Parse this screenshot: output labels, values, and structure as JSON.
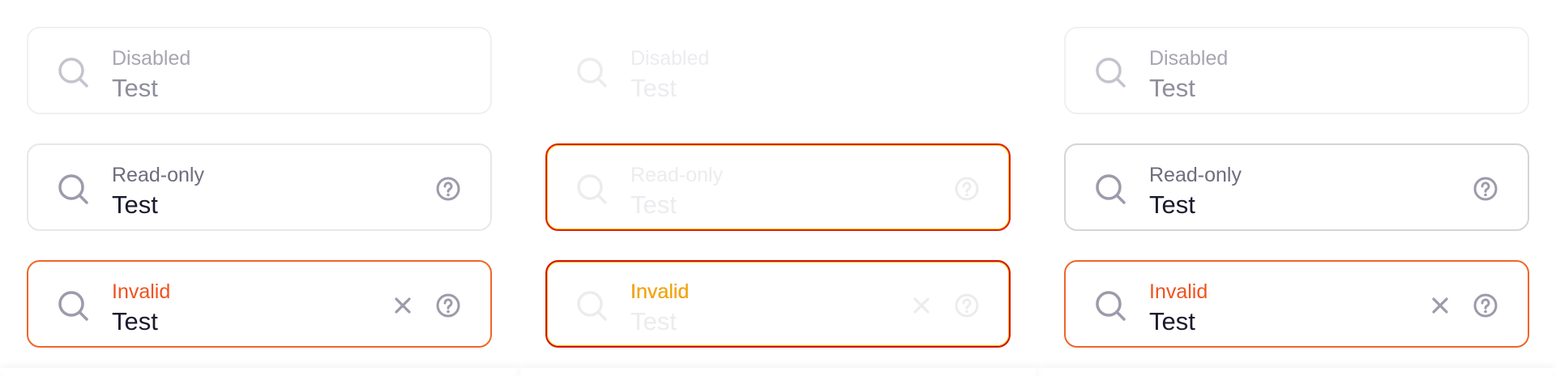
{
  "panels": [
    {
      "fields": {
        "disabled": {
          "label": "Disabled",
          "value": "Test"
        },
        "readonly": {
          "label": "Read-only",
          "value": "Test"
        },
        "invalid": {
          "label": "Invalid",
          "value": "Test"
        }
      }
    },
    {
      "fields": {
        "disabled": {
          "label": "Disabled",
          "value": "Test"
        },
        "readonly": {
          "label": "Read-only",
          "value": "Test"
        },
        "invalid": {
          "label": "Invalid",
          "value": "Test"
        }
      }
    },
    {
      "fields": {
        "disabled": {
          "label": "Disabled",
          "value": "Test"
        },
        "readonly": {
          "label": "Read-only",
          "value": "Test"
        },
        "invalid": {
          "label": "Invalid",
          "value": "Test"
        }
      }
    }
  ],
  "icons": {
    "search": "search-icon",
    "help": "help-circle-icon",
    "clear": "close-icon"
  },
  "colors": {
    "border": "#e7e7ec",
    "invalid_border": "#f16529",
    "invalid_label": "#f0521e",
    "text": "#1a1a2e",
    "label": "#6d6d7e",
    "icon": "#9b9bab"
  }
}
